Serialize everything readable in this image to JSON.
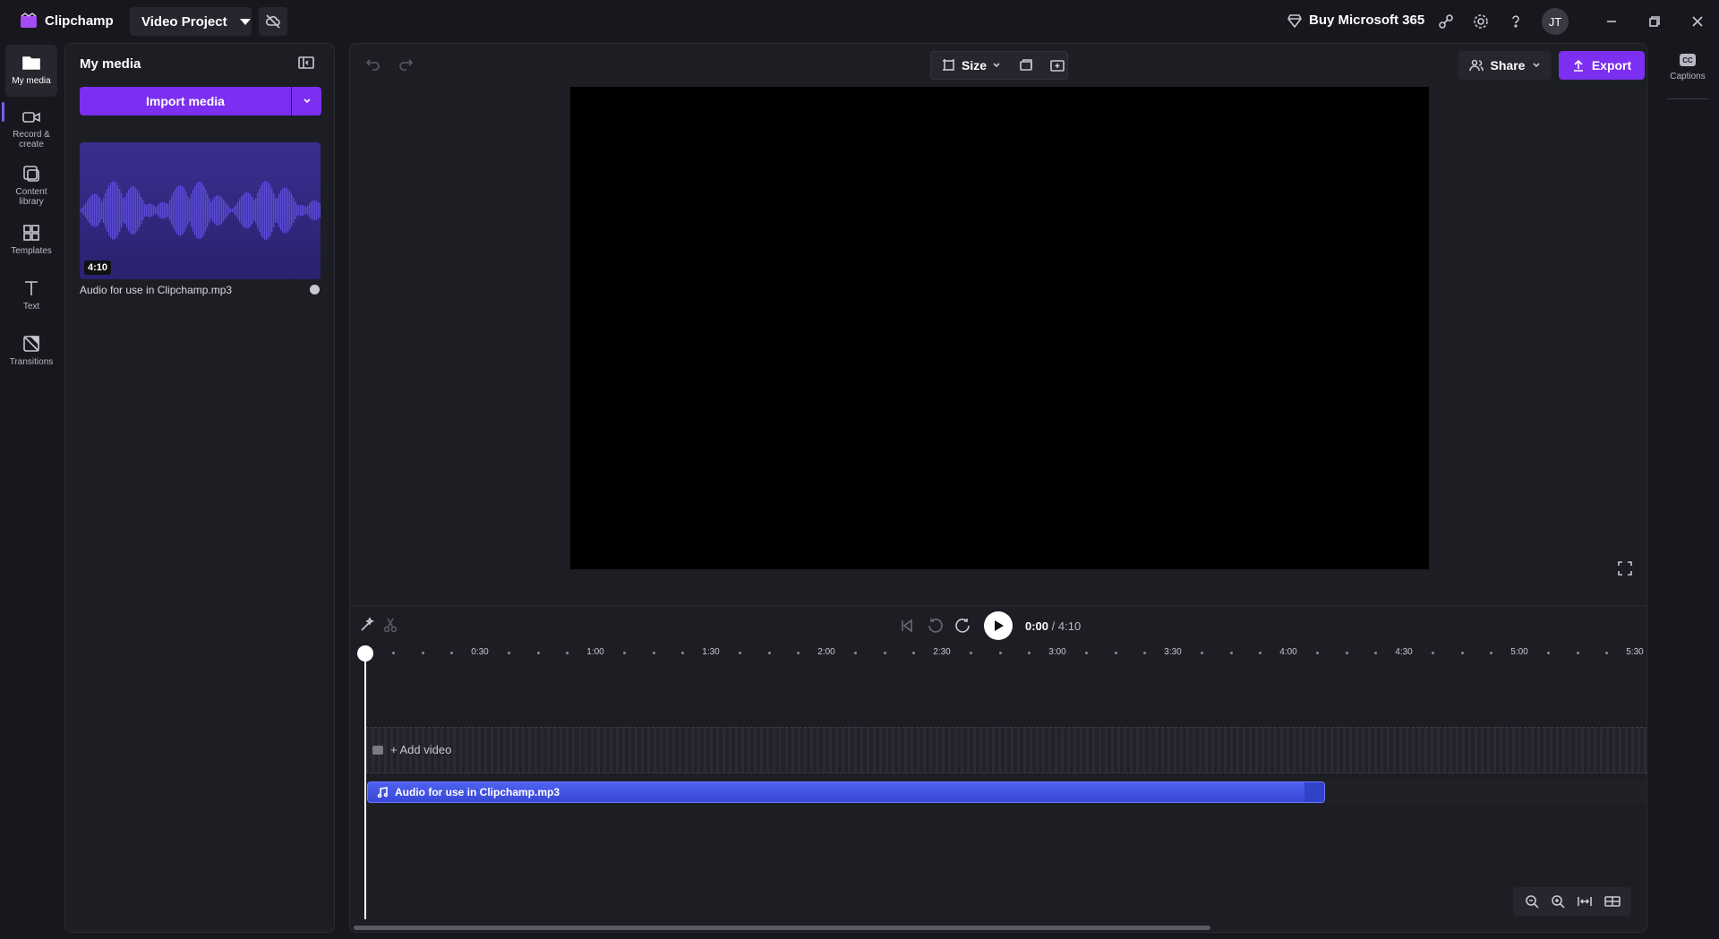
{
  "app": {
    "name": "Clipchamp",
    "project_name": "Video Project"
  },
  "titlebar": {
    "buy_label": "Buy Microsoft 365",
    "avatar_initials": "JT"
  },
  "nav": {
    "items": [
      {
        "label": "My media",
        "icon": "folder-icon"
      },
      {
        "label": "Record & create",
        "icon": "camera-icon"
      },
      {
        "label": "Content library",
        "icon": "content-library-icon"
      },
      {
        "label": "Templates",
        "icon": "templates-icon"
      },
      {
        "label": "Text",
        "icon": "text-icon"
      },
      {
        "label": "Transitions",
        "icon": "transitions-icon"
      }
    ]
  },
  "media_panel": {
    "title": "My media",
    "import_label": "Import media",
    "items": [
      {
        "name": "Audio for use in Clipchamp.mp3",
        "duration": "4:10"
      }
    ]
  },
  "toolbar": {
    "size_label": "Size",
    "share_label": "Share",
    "export_label": "Export"
  },
  "player": {
    "current_time": "0:00",
    "total_time": "/ 4:10"
  },
  "timeline": {
    "ruler_labels": [
      "0:30",
      "1:00",
      "1:30",
      "2:00",
      "2:30",
      "3:00",
      "3:30",
      "4:00",
      "4:30",
      "5:00",
      "5:30"
    ],
    "add_video_label": "+ Add video",
    "audio_clip_label": "Audio for use in Clipchamp.mp3"
  },
  "right_rail": {
    "captions_label": "Captions",
    "cc_text": "CC"
  },
  "colors": {
    "accent": "#7c2ff0",
    "audio_clip": "#4150e0",
    "background": "#17171d"
  }
}
